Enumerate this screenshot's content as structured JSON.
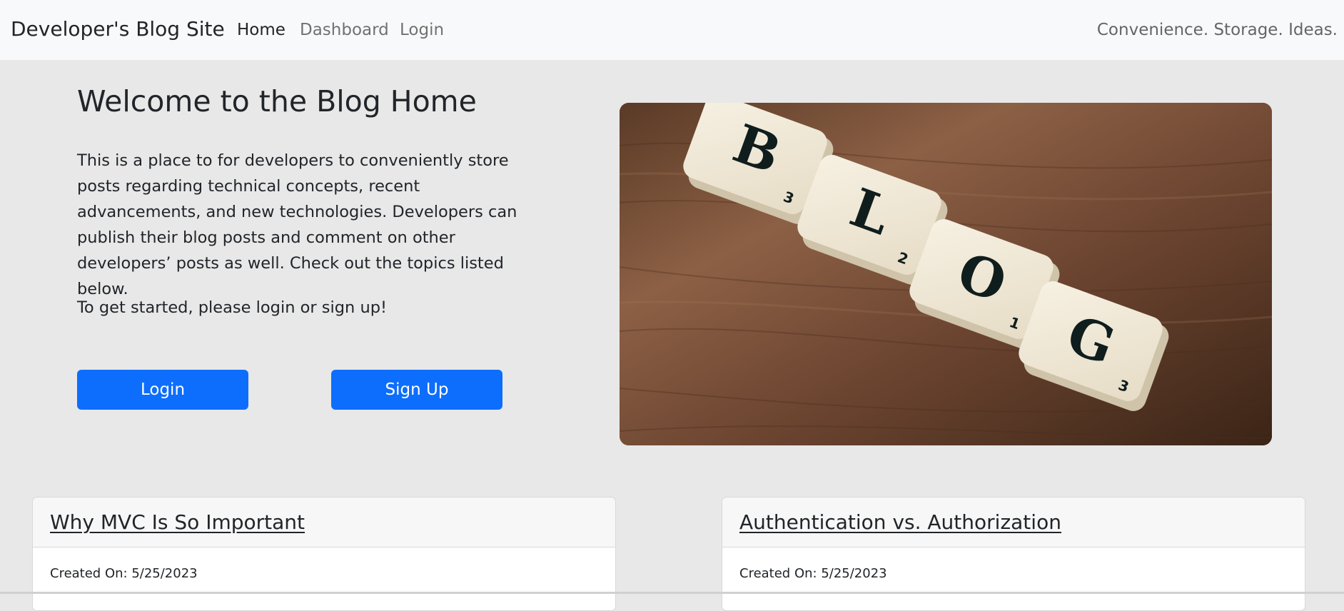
{
  "navbar": {
    "brand": "Developer's Blog Site",
    "links": [
      {
        "label": "Home",
        "active": true
      },
      {
        "label": "Dashboard",
        "active": false
      },
      {
        "label": "Login",
        "active": false
      }
    ],
    "tagline": "Convenience. Storage. Ideas."
  },
  "hero": {
    "title": "Welcome to the Blog Home",
    "description": "This is a place to for developers to conveniently store posts regarding technical concepts, recent advancements, and new technologies. Developers can publish their blog posts and comment on other developers’ posts as well. Check out the topics listed below.",
    "cta": "To get started, please login or sign up!",
    "login_button": "Login",
    "signup_button": "Sign Up",
    "image": {
      "tiles": [
        {
          "letter": "B",
          "score": "3"
        },
        {
          "letter": "L",
          "score": "2"
        },
        {
          "letter": "O",
          "score": "1"
        },
        {
          "letter": "G",
          "score": "3"
        }
      ]
    }
  },
  "posts": [
    {
      "title": "Why MVC Is So Important",
      "created": "Created On: 5/25/2023"
    },
    {
      "title": "Authentication vs. Authorization",
      "created": "Created On: 5/25/2023"
    }
  ],
  "colors": {
    "primary": "#0d6efd",
    "navbar_bg": "#f8f9fa",
    "page_bg": "#e8e8e8",
    "text": "#212529"
  }
}
